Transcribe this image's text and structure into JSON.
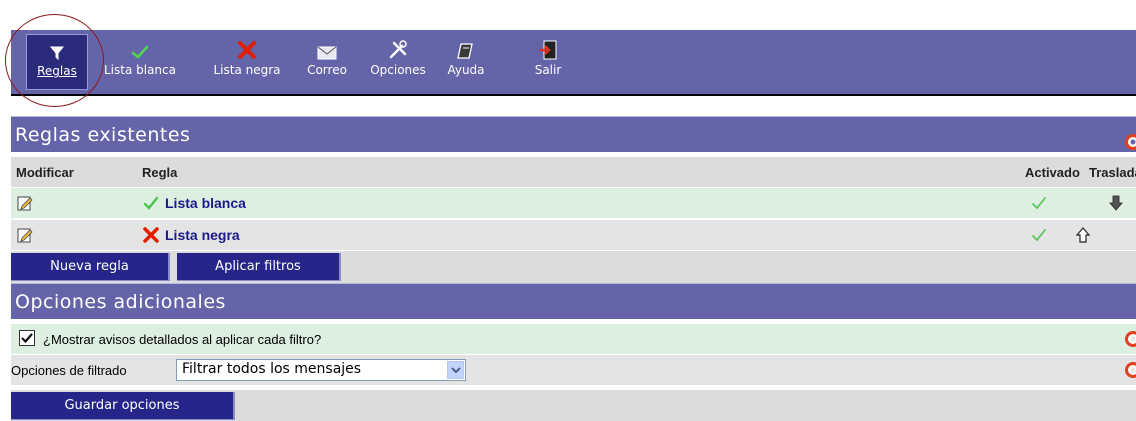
{
  "toolbar": {
    "items": [
      {
        "label": "Reglas",
        "icon": "filter-icon",
        "active": true
      },
      {
        "label": "Lista blanca",
        "icon": "check-icon"
      },
      {
        "label": "Lista negra",
        "icon": "x-icon"
      },
      {
        "label": "Correo",
        "icon": "envelope-icon"
      },
      {
        "label": "Opciones",
        "icon": "tools-icon"
      },
      {
        "label": "Ayuda",
        "icon": "help-book-icon"
      },
      {
        "label": "Salir",
        "icon": "exit-icon"
      }
    ]
  },
  "rules_section": {
    "title": "Reglas existentes",
    "columns": {
      "modify": "Modificar",
      "rule": "Regla",
      "enabled": "Activado",
      "move": "Trasladar"
    },
    "rows": [
      {
        "name": "Lista blanca",
        "status_icon": "check-icon",
        "enabled": true,
        "move": "down"
      },
      {
        "name": "Lista negra",
        "status_icon": "x-icon",
        "enabled": true,
        "move": "up"
      }
    ],
    "buttons": {
      "new_rule": "Nueva regla",
      "apply_filters": "Aplicar filtros"
    }
  },
  "options_section": {
    "title": "Opciones adicionales",
    "show_warnings_label": "¿Mostrar avisos detallados al aplicar cada filtro?",
    "show_warnings_checked": true,
    "filter_options_label": "Opciones de filtrado",
    "filter_options_value": "Filtrar todos los mensajes",
    "save_button": "Guardar opciones"
  },
  "colors": {
    "header": "#6464a8",
    "button": "#26268a",
    "green_row": "#ddefe0",
    "gray_row": "#e4e4e4"
  }
}
